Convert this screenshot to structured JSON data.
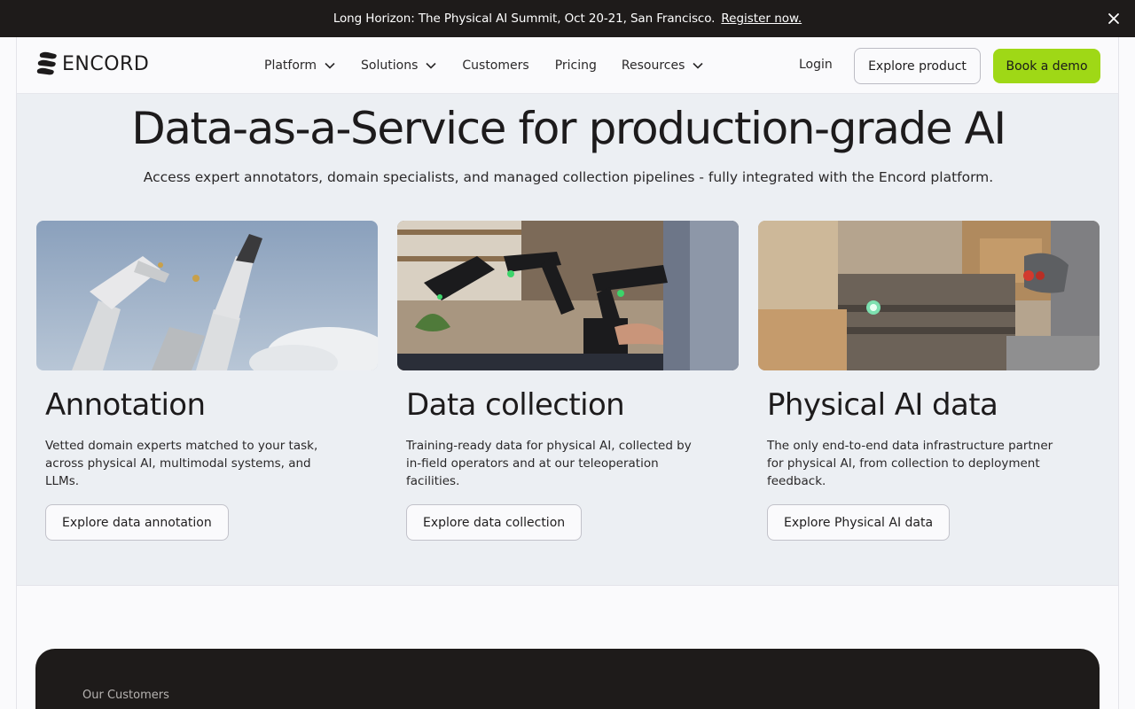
{
  "announcement": {
    "message": "Long Horizon: The Physical AI Summit, Oct 20-21, San Francisco.",
    "cta": "Register now."
  },
  "header": {
    "brand": "ENCORD",
    "nav": [
      {
        "label": "Platform"
      },
      {
        "label": "Solutions"
      },
      {
        "label": "Customers"
      },
      {
        "label": "Pricing"
      },
      {
        "label": "Resources"
      }
    ],
    "login": "Login",
    "explore_product": "Explore product",
    "book_demo": "Book a demo"
  },
  "hero": {
    "title": "Data-as-a-Service for production-grade AI",
    "subtitle": "Access expert annotators, domain specialists, and managed collection pipelines - fully integrated with the Encord platform."
  },
  "cards": [
    {
      "title": "Annotation",
      "description": "Vetted domain experts matched to your task, across physical AI, multimodal systems, and LLMs.",
      "button": "Explore data annotation"
    },
    {
      "title": "Data collection",
      "description": "Training-ready data for physical AI, collected by in-field operators and at our teleoperation facilities.",
      "button": "Explore data collection"
    },
    {
      "title": "Physical AI data",
      "description": "The only end-to-end data infrastructure partner for physical AI, from collection to deployment feedback.",
      "button": "Explore Physical AI data"
    }
  ],
  "customers": {
    "label": "Our Customers"
  },
  "colors": {
    "announcement_bg": "#1e1b1a",
    "accent_green": "#9fd816",
    "hero_bg": "#eceff3"
  }
}
